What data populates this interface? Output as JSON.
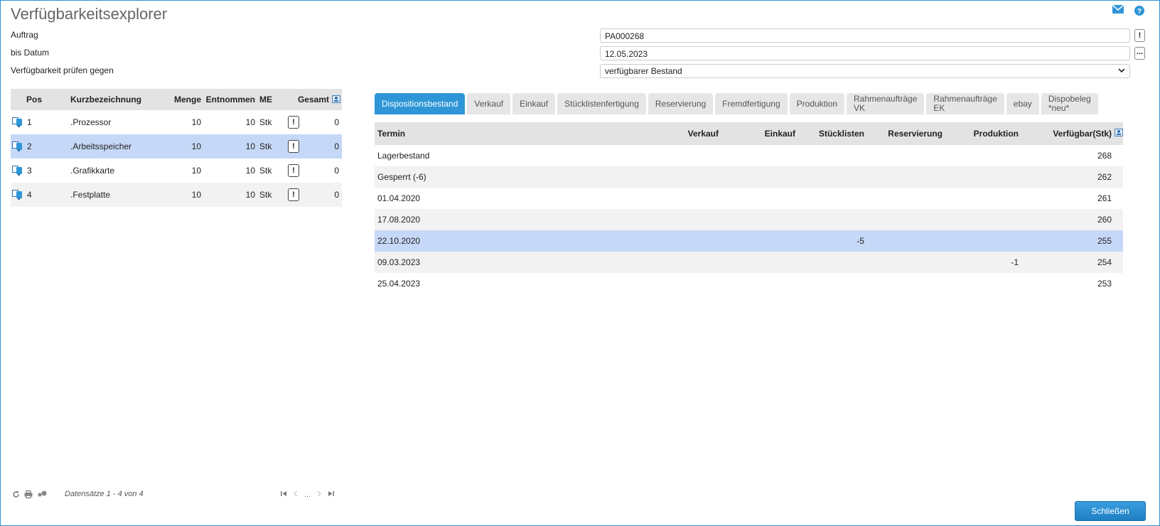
{
  "window": {
    "title": "Verfügbarkeitsexplorer"
  },
  "header_icons": [
    "mail-icon",
    "help-icon"
  ],
  "form": {
    "auftrag_label": "Auftrag",
    "auftrag_value": "PA000268",
    "auftrag_btn": "!",
    "datum_label": "bis Datum",
    "datum_value": "12.05.2023",
    "datum_btn": "...",
    "pruefen_label": "Verfügbarkeit prüfen gegen",
    "pruefen_value": "verfügbarer Bestand"
  },
  "positions": {
    "columns": {
      "pos": "Pos",
      "kurz": "Kurzbezeichnung",
      "menge": "Menge",
      "entnommen": "Entnommen",
      "me": "ME",
      "gesamt": "Gesamt"
    },
    "rows": [
      {
        "pos": "1",
        "kurz": ".Prozessor",
        "menge": "10",
        "entnommen": "10",
        "me": "Stk",
        "warn": "!",
        "gesamt": "0"
      },
      {
        "pos": "2",
        "kurz": ".Arbeitsspeicher",
        "menge": "10",
        "entnommen": "10",
        "me": "Stk",
        "warn": "!",
        "gesamt": "0"
      },
      {
        "pos": "3",
        "kurz": ".Grafikkarte",
        "menge": "10",
        "entnommen": "10",
        "me": "Stk",
        "warn": "!",
        "gesamt": "0"
      },
      {
        "pos": "4",
        "kurz": ".Festplatte",
        "menge": "10",
        "entnommen": "10",
        "me": "Stk",
        "warn": "!",
        "gesamt": "0"
      }
    ],
    "selected_index": 1,
    "footer": {
      "records": "Datensätze 1 - 4 von 4",
      "pager_mid": "..."
    }
  },
  "tabs": [
    {
      "label": "Dispositionsbestand",
      "active": true
    },
    {
      "label": "Verkauf"
    },
    {
      "label": "Einkauf"
    },
    {
      "label": "Stücklistenfertigung"
    },
    {
      "label": "Reservierung"
    },
    {
      "label": "Fremdfertigung"
    },
    {
      "label": "Produktion"
    },
    {
      "label_line1": "Rahmenaufträge",
      "label_line2": "VK"
    },
    {
      "label_line1": "Rahmenaufträge",
      "label_line2": "EK"
    },
    {
      "label": "ebay"
    },
    {
      "label_line1": "Dispobeleg",
      "label_line2": "*neu*"
    }
  ],
  "dispo": {
    "columns": {
      "termin": "Termin",
      "verkauf": "Verkauf",
      "einkauf": "Einkauf",
      "stuecklisten": "Stücklisten",
      "reservierung": "Reservierung",
      "produktion": "Produktion",
      "verfuegbar": "Verfügbar(Stk)"
    },
    "rows": [
      {
        "termin": "Lagerbestand",
        "verkauf": "",
        "einkauf": "",
        "stuecklisten": "",
        "reservierung": "",
        "produktion": "",
        "verfuegbar": "268"
      },
      {
        "termin": "Gesperrt (-6)",
        "verkauf": "",
        "einkauf": "",
        "stuecklisten": "",
        "reservierung": "",
        "produktion": "",
        "verfuegbar": "262"
      },
      {
        "termin": "01.04.2020",
        "verkauf": "",
        "einkauf": "",
        "stuecklisten": "",
        "reservierung": "",
        "produktion": "",
        "verfuegbar": "261"
      },
      {
        "termin": "17.08.2020",
        "verkauf": "",
        "einkauf": "",
        "stuecklisten": "",
        "reservierung": "",
        "produktion": "",
        "verfuegbar": "260"
      },
      {
        "termin": "22.10.2020",
        "verkauf": "",
        "einkauf": "",
        "stuecklisten": "-5",
        "reservierung": "",
        "produktion": "",
        "verfuegbar": "255"
      },
      {
        "termin": "09.03.2023",
        "verkauf": "",
        "einkauf": "",
        "stuecklisten": "",
        "reservierung": "",
        "produktion": "-1",
        "verfuegbar": "254"
      },
      {
        "termin": "25.04.2023",
        "verkauf": "",
        "einkauf": "",
        "stuecklisten": "",
        "reservierung": "",
        "produktion": "",
        "verfuegbar": "253"
      }
    ],
    "selected_index": 4
  },
  "buttons": {
    "close": "Schließen"
  },
  "colors": {
    "accent": "#2e96d6",
    "selection": "#c6d8f7",
    "header_bg": "#e3e3e3"
  }
}
